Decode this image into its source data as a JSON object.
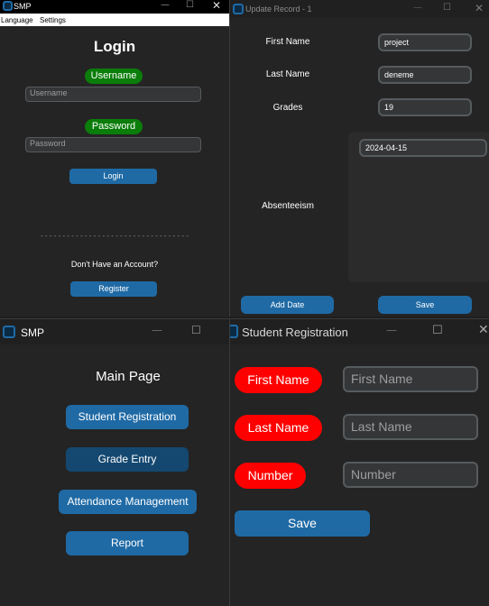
{
  "login_window": {
    "title": "SMP",
    "menu": [
      "Language",
      "Settings"
    ],
    "heading": "Login",
    "username_label": "Username",
    "username_placeholder": "Username",
    "password_label": "Password",
    "password_placeholder": "Password",
    "login_button": "Login",
    "divider": "- - - - - - - - - - - - - - - - - - - - - - - - - - - - - - - - - -",
    "no_account_text": "Don't Have an Account?",
    "register_button": "Register"
  },
  "update_window": {
    "title": "Update Record - 1",
    "first_name_label": "First Name",
    "first_name_value": "project",
    "last_name_label": "Last Name",
    "last_name_value": "deneme",
    "grades_label": "Grades",
    "grades_value": "19",
    "absenteeism_label": "Absenteeism",
    "date_value": "2024-04-15",
    "add_date_button": "Add Date",
    "save_button": "Save"
  },
  "main_window": {
    "title": "SMP",
    "heading": "Main Page",
    "buttons": [
      "Student Registration",
      "Grade Entry",
      "Attendance Management",
      "Report"
    ]
  },
  "registration_window": {
    "title": "Student Registration",
    "first_name_label": "First Name",
    "first_name_placeholder": "First Name",
    "last_name_label": "Last Name",
    "last_name_placeholder": "Last Name",
    "number_label": "Number",
    "number_placeholder": "Number",
    "save_button": "Save"
  },
  "colors": {
    "accent": "#1f6aa5",
    "green_label": "#0a7d0a",
    "red_label": "#ff0000",
    "window_bg": "#242424"
  }
}
